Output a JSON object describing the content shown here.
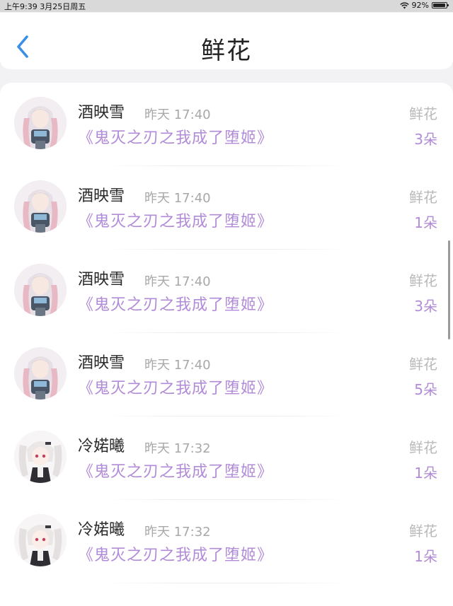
{
  "status_bar": {
    "left": "上午9:39   3月25日周五",
    "battery": "92%",
    "battery_level": 0.92
  },
  "header": {
    "title": "鲜花"
  },
  "colors": {
    "accent": "#b18bd8",
    "back": "#3a8ee6"
  },
  "records": [
    {
      "name": "酒映雪",
      "time": "昨天 17:40",
      "book": "《鬼灭之刃之我成了堕姬》",
      "gift": "鲜花",
      "count": "3朵",
      "avatar": "white-hair-avatar"
    },
    {
      "name": "酒映雪",
      "time": "昨天 17:40",
      "book": "《鬼灭之刃之我成了堕姬》",
      "gift": "鲜花",
      "count": "1朵",
      "avatar": "white-hair-avatar"
    },
    {
      "name": "酒映雪",
      "time": "昨天 17:40",
      "book": "《鬼灭之刃之我成了堕姬》",
      "gift": "鲜花",
      "count": "3朵",
      "avatar": "white-hair-avatar"
    },
    {
      "name": "酒映雪",
      "time": "昨天 17:40",
      "book": "《鬼灭之刃之我成了堕姬》",
      "gift": "鲜花",
      "count": "5朵",
      "avatar": "white-hair-avatar"
    },
    {
      "name": "冷婼曦",
      "time": "昨天 17:32",
      "book": "《鬼灭之刃之我成了堕姬》",
      "gift": "鲜花",
      "count": "1朵",
      "avatar": "twin-tail-avatar"
    },
    {
      "name": "冷婼曦",
      "time": "昨天 17:32",
      "book": "《鬼灭之刃之我成了堕姬》",
      "gift": "鲜花",
      "count": "1朵",
      "avatar": "twin-tail-avatar"
    }
  ]
}
